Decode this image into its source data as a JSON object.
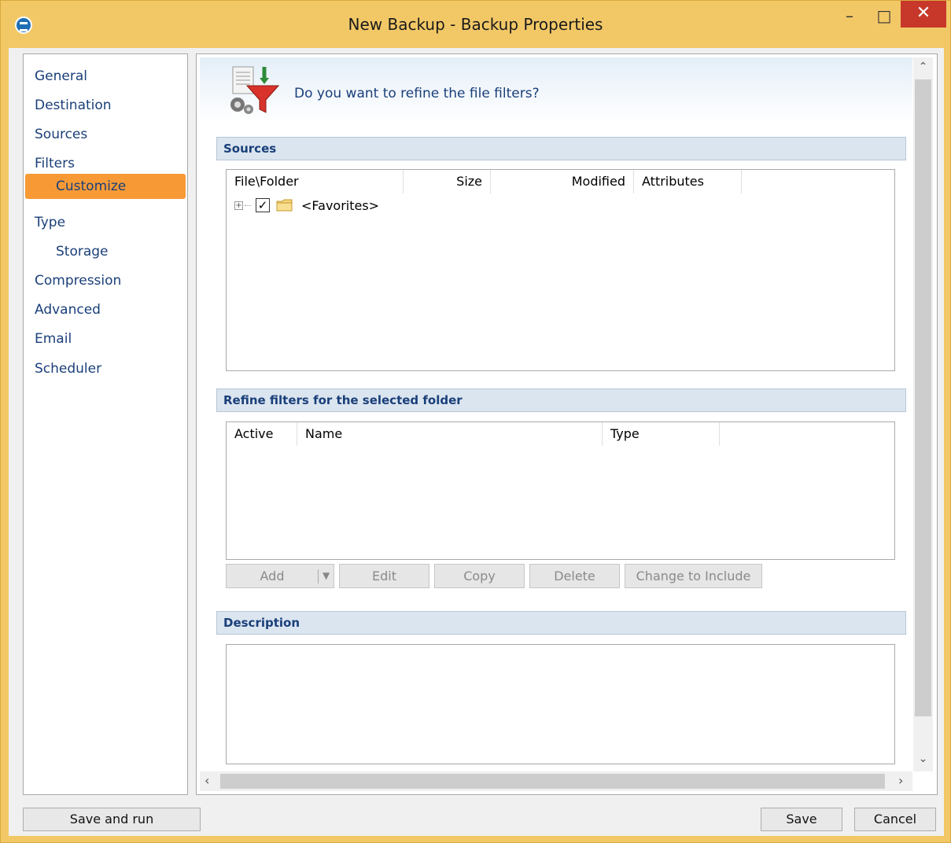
{
  "window": {
    "title": "New Backup - Backup Properties"
  },
  "titlebar": {
    "minimize": "–",
    "maximize": "□",
    "close": "✕"
  },
  "nav": {
    "items": [
      {
        "label": "General"
      },
      {
        "label": "Destination"
      },
      {
        "label": "Sources"
      },
      {
        "label": "Filters"
      },
      {
        "label": "Customize",
        "selected": true
      },
      {
        "label": "Type"
      },
      {
        "label": "Storage"
      },
      {
        "label": "Compression"
      },
      {
        "label": "Advanced"
      },
      {
        "label": "Email"
      },
      {
        "label": "Scheduler"
      }
    ]
  },
  "header": {
    "question": "Do you want to refine the file filters?"
  },
  "sources": {
    "title": "Sources",
    "columns": [
      "File\\Folder",
      "Size",
      "Modified",
      "Attributes"
    ],
    "rows": [
      {
        "label": "<Favorites>",
        "checked": true,
        "expand": "+"
      }
    ]
  },
  "refine": {
    "title": "Refine filters for the selected folder",
    "columns": [
      "Active",
      "Name",
      "Type"
    ],
    "buttons": {
      "add": "Add",
      "edit": "Edit",
      "copy": "Copy",
      "delete": "Delete",
      "change": "Change to Include"
    }
  },
  "description": {
    "title": "Description",
    "text": ""
  },
  "footer": {
    "save_run": "Save and run",
    "save": "Save",
    "cancel": "Cancel"
  },
  "colors": {
    "titlebar": "#f2c867",
    "selected_nav": "#f79a35",
    "section_header": "#dbe5ef",
    "close_button": "#c7382b"
  }
}
